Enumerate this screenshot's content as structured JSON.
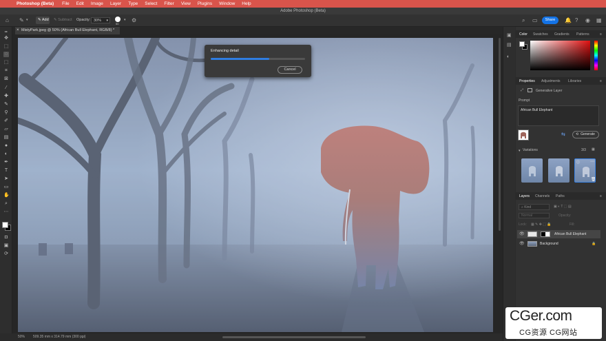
{
  "menubar": {
    "apple": "",
    "app_name": "Photoshop (Beta)",
    "items": [
      "File",
      "Edit",
      "Image",
      "Layer",
      "Type",
      "Select",
      "Filter",
      "View",
      "Plugins",
      "Window",
      "Help"
    ]
  },
  "window": {
    "title": "Adobe Photoshop (Beta)"
  },
  "options": {
    "add_label": "Add",
    "subtract_label": "Subtract",
    "opacity_label": "Opacity:",
    "opacity_value": "30%",
    "brush_size": "50",
    "share_label": "Share"
  },
  "document": {
    "tab_label": "MistyPark.jpeg @ 50% (African Bull Elephant, RGB/8) *",
    "zoom": "50%",
    "dimensions": "509.35 mm x 314.79 mm (300 ppi)"
  },
  "dialog": {
    "title": "Enhancing detail",
    "progress": 0.62,
    "cancel_label": "Cancel"
  },
  "color_panel": {
    "tabs": [
      "Color",
      "Swatches",
      "Gradients",
      "Patterns"
    ],
    "fg_color": "#ffffff",
    "bg_color": "#000000"
  },
  "properties_panel": {
    "tabs": [
      "Properties",
      "Adjustments",
      "Libraries"
    ],
    "layer_type": "Generative Layer",
    "prompt_label": "Prompt",
    "prompt_value": "African Bull Elephant",
    "generate_label": "Generate",
    "variations_label": "Variations",
    "variations_count": "3/3"
  },
  "layers_panel": {
    "tabs": [
      "Layers",
      "Channels",
      "Paths"
    ],
    "kind_placeholder": "Kind",
    "blend_mode": "Normal",
    "opacity_label": "Opacity:",
    "lock_label": "Lock:",
    "fill_label": "Fill:",
    "layers": [
      {
        "name": "African Bull Elephant",
        "selected": true
      },
      {
        "name": "Background",
        "selected": false
      }
    ]
  },
  "watermark": {
    "big": "CGer.com",
    "small": "CG资源 CG网站"
  },
  "accent_color": "#1473e6"
}
